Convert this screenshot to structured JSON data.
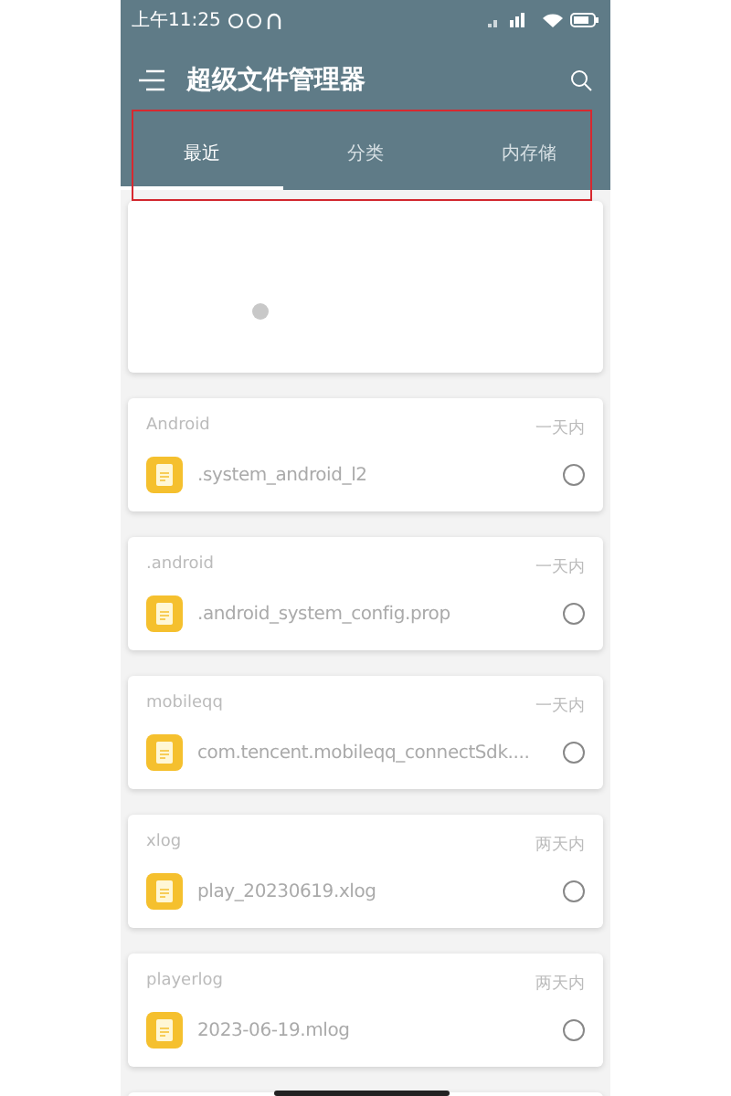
{
  "status_bar": {
    "time": "上午11:25"
  },
  "app_bar": {
    "title": "超级文件管理器"
  },
  "tabs": [
    {
      "label": "最近",
      "selected": true
    },
    {
      "label": "分类",
      "selected": false
    },
    {
      "label": "内存储",
      "selected": false
    }
  ],
  "files": [
    {
      "folder": "Android",
      "when": "一天内",
      "name": ".system_android_l2",
      "selected": false
    },
    {
      "folder": ".android",
      "when": "一天内",
      "name": ".android_system_config.prop",
      "selected": false
    },
    {
      "folder": "mobileqq",
      "when": "一天内",
      "name": "com.tencent.mobileqq_connectSdk....",
      "selected": false
    },
    {
      "folder": "xlog",
      "when": "两天内",
      "name": "play_20230619.xlog",
      "selected": false
    },
    {
      "folder": "playerlog",
      "when": "两天内",
      "name": "2023-06-19.mlog",
      "selected": false
    }
  ]
}
